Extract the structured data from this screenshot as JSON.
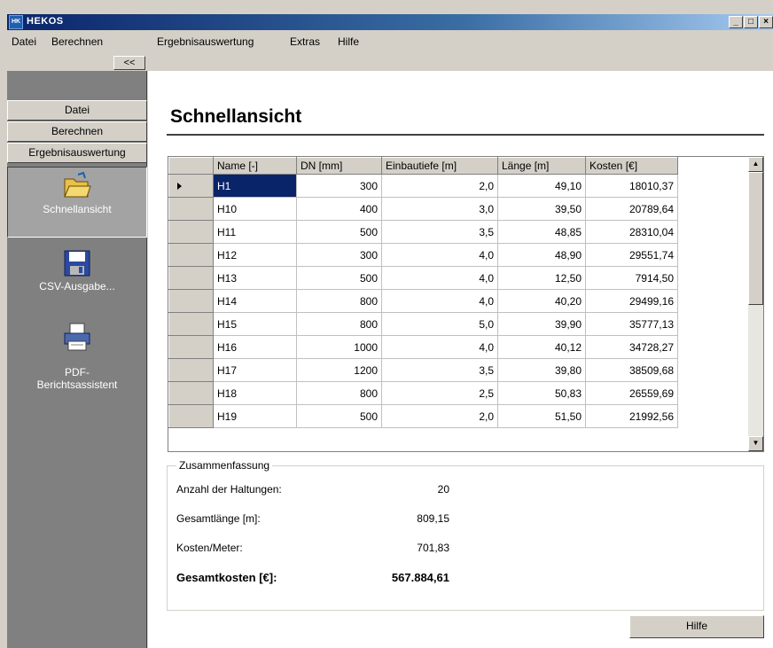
{
  "window": {
    "title": "HEKOS",
    "icon_text": "HK"
  },
  "menu": [
    "Datei",
    "Berechnen",
    "Ergebnisauswertung",
    "Extras",
    "Hilfe"
  ],
  "sidebar": {
    "collapse_label": "<<",
    "groups": [
      "Datei",
      "Berechnen",
      "Ergebnisauswertung"
    ],
    "tools": [
      {
        "label": "Schnellansicht",
        "icon": "folder-open-icon",
        "selected": true
      },
      {
        "label": "CSV-Ausgabe...",
        "icon": "floppy-disk-icon",
        "selected": false
      },
      {
        "label": "PDF-\nBerichtsassistent",
        "icon": "printer-icon",
        "selected": false
      }
    ]
  },
  "main": {
    "title": "Schnellansicht",
    "table": {
      "columns": [
        "Name [-]",
        "DN [mm]",
        "Einbautiefe [m]",
        "Länge [m]",
        "Kosten [€]"
      ],
      "rows": [
        [
          "H1",
          "300",
          "2,0",
          "49,10",
          "18010,37"
        ],
        [
          "H10",
          "400",
          "3,0",
          "39,50",
          "20789,64"
        ],
        [
          "H11",
          "500",
          "3,5",
          "48,85",
          "28310,04"
        ],
        [
          "H12",
          "300",
          "4,0",
          "48,90",
          "29551,74"
        ],
        [
          "H13",
          "500",
          "4,0",
          "12,50",
          "7914,50"
        ],
        [
          "H14",
          "800",
          "4,0",
          "40,20",
          "29499,16"
        ],
        [
          "H15",
          "800",
          "5,0",
          "39,90",
          "35777,13"
        ],
        [
          "H16",
          "1000",
          "4,0",
          "40,12",
          "34728,27"
        ],
        [
          "H17",
          "1200",
          "3,5",
          "39,80",
          "38509,68"
        ],
        [
          "H18",
          "800",
          "2,5",
          "50,83",
          "26559,69"
        ],
        [
          "H19",
          "500",
          "2,0",
          "51,50",
          "21992,56"
        ]
      ]
    },
    "summary": {
      "legend": "Zusammenfassung",
      "anzahl_label": "Anzahl der Haltungen:",
      "anzahl_value": "20",
      "laenge_label": "Gesamtlänge [m]:",
      "laenge_value": "809,15",
      "kosten_meter_label": "Kosten/Meter:",
      "kosten_meter_value": "701,83",
      "gesamtkosten_label": "Gesamtkosten [€]:",
      "gesamtkosten_value": "567.884,61"
    },
    "help_button": "Hilfe"
  }
}
